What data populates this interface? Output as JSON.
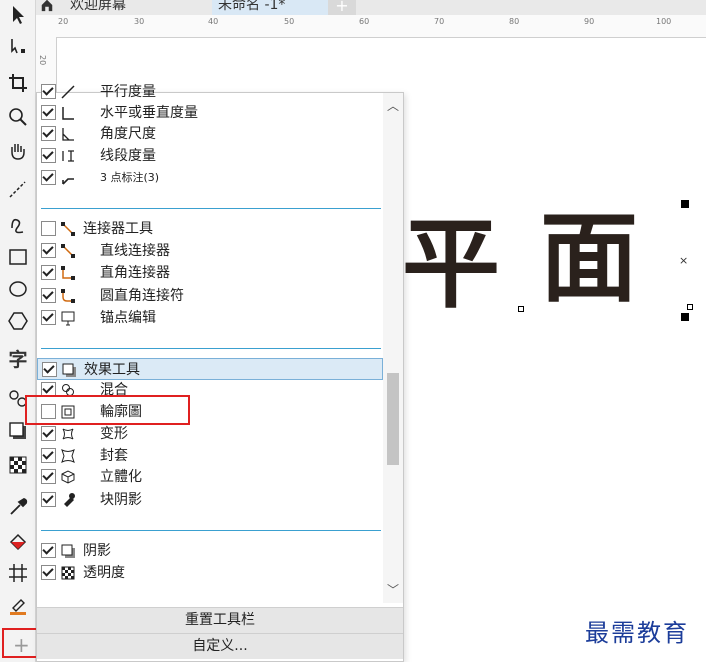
{
  "tabs": {
    "home_icon": "home-icon",
    "welcome": "欢迎屏幕",
    "document": "未命名 -1*",
    "new_tab": "+"
  },
  "ruler": {
    "top_numbers": [
      "20",
      "30",
      "40",
      "50",
      "60",
      "70",
      "80",
      "90",
      "100"
    ],
    "left_numbers": [
      "20"
    ]
  },
  "toolbox": [
    {
      "name": "pick-tool-icon"
    },
    {
      "name": "shape-tool-icon"
    },
    {
      "name": "crop-tool-icon"
    },
    {
      "name": "zoom-tool-icon"
    },
    {
      "name": "pan-tool-icon"
    },
    {
      "name": "freehand-tool-icon"
    },
    {
      "name": "artistic-media-icon"
    },
    {
      "name": "rectangle-tool-icon"
    },
    {
      "name": "ellipse-tool-icon"
    },
    {
      "name": "polygon-tool-icon"
    },
    {
      "name": "text-tool-icon",
      "glyph": "字"
    },
    {
      "name": "blend-tool-icon"
    },
    {
      "name": "drop-shadow-tool-icon"
    },
    {
      "name": "transparency-tool-icon"
    },
    {
      "name": "eyedropper-tool-icon"
    },
    {
      "name": "interactive-fill-icon"
    },
    {
      "name": "smart-fill-icon"
    },
    {
      "name": "outline-pen-icon"
    }
  ],
  "toolbox_add": "+",
  "canvas": {
    "chars": [
      "平",
      "面"
    ],
    "watermark": "最需教育"
  },
  "panel": {
    "rows": [
      {
        "label": "平行度量",
        "checked": true,
        "icon": "parallel-dimension-icon",
        "indent": true
      },
      {
        "label": "水平或垂直度量",
        "checked": true,
        "icon": "horizontal-vertical-dimension-icon",
        "indent": true
      },
      {
        "label": "角度尺度",
        "checked": true,
        "icon": "angular-dimension-icon",
        "indent": true
      },
      {
        "label": "线段度量",
        "checked": true,
        "icon": "segment-dimension-icon",
        "indent": true
      },
      {
        "label": "3 点标注(3)",
        "checked": true,
        "icon": "three-point-callout-icon",
        "indent": true,
        "small": true
      },
      {
        "label": "连接器工具",
        "checked": false,
        "icon": "connector-tool-icon",
        "indent": false
      },
      {
        "label": "直线连接器",
        "checked": true,
        "icon": "straight-connector-icon",
        "indent": true
      },
      {
        "label": "直角连接器",
        "checked": true,
        "icon": "right-angle-connector-icon",
        "indent": true
      },
      {
        "label": "圆直角连接符",
        "checked": true,
        "icon": "rounded-connector-icon",
        "indent": true
      },
      {
        "label": "锚点编辑",
        "checked": true,
        "icon": "anchor-edit-icon",
        "indent": true
      },
      {
        "label": "效果工具",
        "checked": true,
        "icon": "effects-tool-icon",
        "indent": false
      },
      {
        "label": "混合",
        "checked": true,
        "icon": "blend-icon",
        "indent": true
      },
      {
        "label": "輪廓圖",
        "checked": false,
        "icon": "contour-icon",
        "indent": true
      },
      {
        "label": "变形",
        "checked": true,
        "icon": "distort-icon",
        "indent": true
      },
      {
        "label": "封套",
        "checked": true,
        "icon": "envelope-icon",
        "indent": true
      },
      {
        "label": "立體化",
        "checked": true,
        "icon": "extrude-icon",
        "indent": true
      },
      {
        "label": "块阴影",
        "checked": true,
        "icon": "block-shadow-icon",
        "indent": true
      },
      {
        "label": "阴影",
        "checked": true,
        "icon": "shadow-icon",
        "indent": false
      },
      {
        "label": "透明度",
        "checked": true,
        "icon": "transparency-icon",
        "indent": false
      }
    ],
    "reset_button": "重置工具栏",
    "customize_button": "自定义..."
  }
}
